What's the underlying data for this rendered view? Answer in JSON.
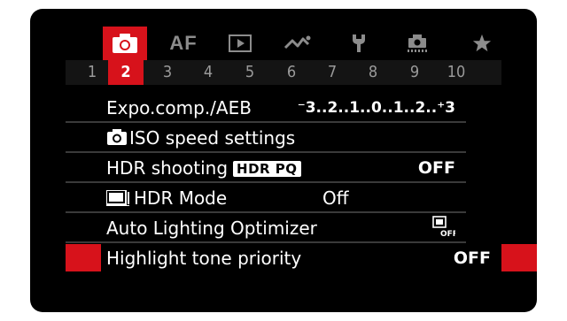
{
  "tabs": [
    {
      "icon": "camera-icon",
      "active": true
    },
    {
      "label": "AF"
    },
    {
      "icon": "playback-icon"
    },
    {
      "icon": "wireless-icon"
    },
    {
      "icon": "wrench-icon"
    },
    {
      "icon": "custom-function-icon"
    },
    {
      "icon": "star-icon"
    }
  ],
  "pages": [
    "1",
    "2",
    "3",
    "4",
    "5",
    "6",
    "7",
    "8",
    "9",
    "10"
  ],
  "active_page": "2",
  "rows": {
    "expo": {
      "label": "Expo.comp./AEB",
      "scale": "⁻3..2..1..0..1..2..⁺3"
    },
    "iso": {
      "label": "ISO speed settings"
    },
    "hdr": {
      "label": "HDR shooting",
      "badge": "HDR PQ",
      "value": "OFF"
    },
    "hdrmode": {
      "label": "HDR Mode",
      "value": "Off"
    },
    "alo": {
      "label": "Auto Lighting Optimizer",
      "value_icon": "alo-off-icon"
    },
    "htp": {
      "label": "Highlight tone priority",
      "value": "OFF"
    }
  },
  "colors": {
    "accent": "#d7121b",
    "background": "#000000",
    "text": "#ffffff",
    "inactive": "#8c8c8c"
  }
}
